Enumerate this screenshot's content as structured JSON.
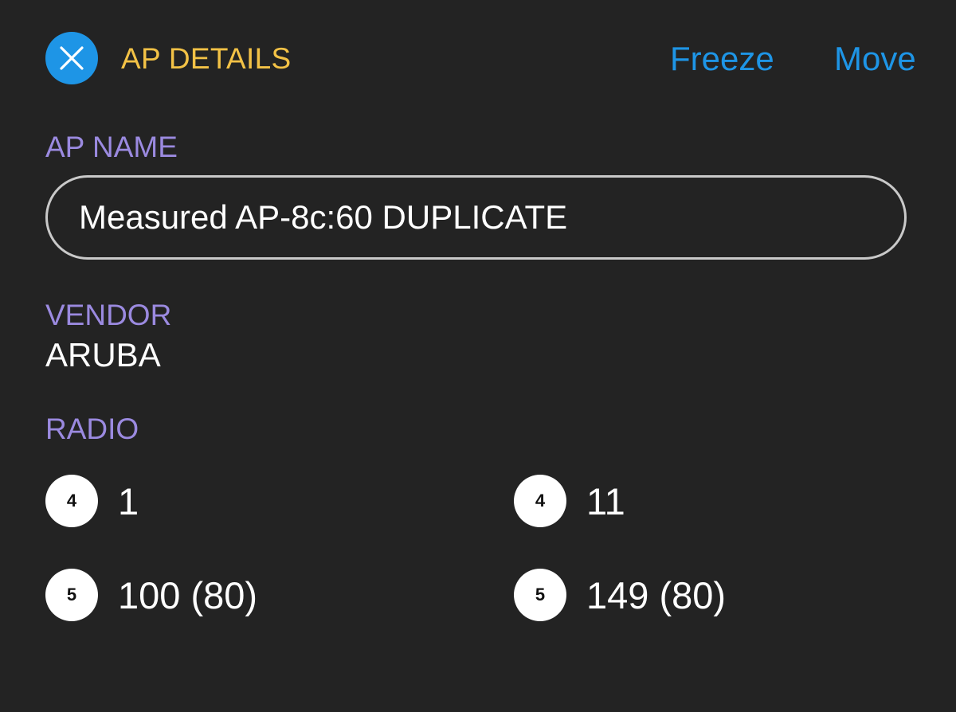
{
  "header": {
    "title": "AP DETAILS",
    "close_icon": "close-icon",
    "freeze_label": "Freeze",
    "move_label": "Move"
  },
  "ap_name": {
    "label": "AP NAME",
    "value": "Measured AP-8c:60 DUPLICATE"
  },
  "vendor": {
    "label": "VENDOR",
    "value": "ARUBA"
  },
  "radio": {
    "label": "RADIO",
    "items": [
      {
        "band": "4",
        "channel": "1"
      },
      {
        "band": "4",
        "channel": "11"
      },
      {
        "band": "5",
        "channel": "100 (80)"
      },
      {
        "band": "5",
        "channel": "149 (80)"
      }
    ]
  },
  "colors": {
    "background": "#232323",
    "accent_blue": "#1e95e6",
    "title_yellow": "#f3c246",
    "label_purple": "#9b8ae0"
  }
}
